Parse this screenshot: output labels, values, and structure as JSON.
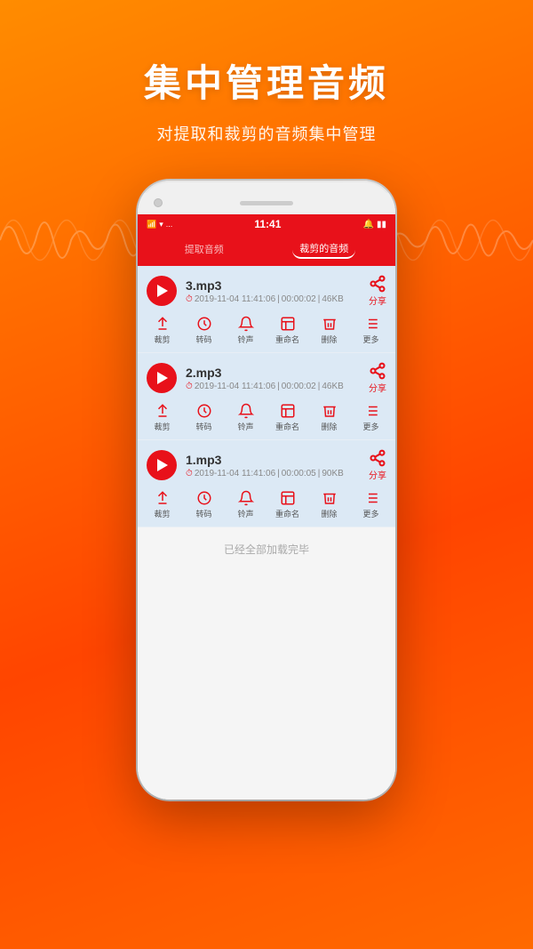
{
  "app": {
    "background_gradient_start": "#ff8c00",
    "background_gradient_end": "#ff4500"
  },
  "header": {
    "main_title": "集中管理音频",
    "sub_title": "对提取和裁剪的音频集中管理"
  },
  "phone": {
    "status_bar": {
      "signal": "信号",
      "wifi": "WiFi",
      "dots": "...",
      "time": "11:41",
      "battery": "电量"
    },
    "tabs": [
      {
        "label": "提取音频",
        "active": false
      },
      {
        "label": "裁剪的音频",
        "active": true
      }
    ],
    "audio_items": [
      {
        "name": "3.mp3",
        "date": "2019-11-04 11:41:06",
        "duration": "00:00:02",
        "size": "46KB",
        "share_label": "分享"
      },
      {
        "name": "2.mp3",
        "date": "2019-11-04 11:41:06",
        "duration": "00:00:02",
        "size": "46KB",
        "share_label": "分享"
      },
      {
        "name": "1.mp3",
        "date": "2019-11-04 11:41:06",
        "duration": "00:00:05",
        "size": "90KB",
        "share_label": "分享"
      }
    ],
    "action_buttons": [
      {
        "label": "裁剪"
      },
      {
        "label": "转码"
      },
      {
        "label": "铃声"
      },
      {
        "label": "重命名"
      },
      {
        "label": "删除"
      },
      {
        "label": "更多"
      }
    ],
    "footer_text": "已经全部加载完毕"
  }
}
